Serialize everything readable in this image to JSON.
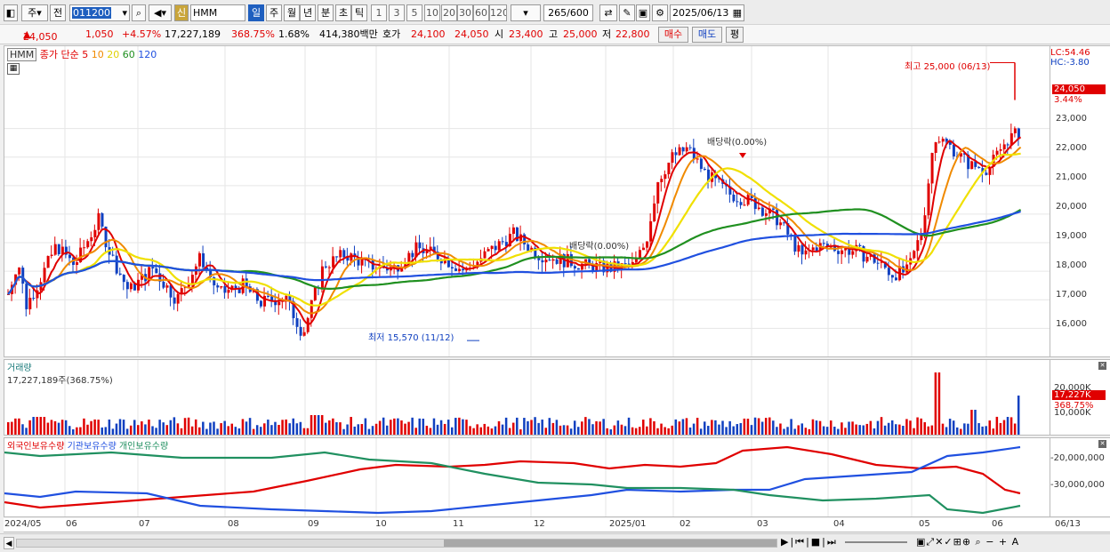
{
  "toolbar": {
    "period_label": "주",
    "compare_label": "전",
    "stock_code": "011200",
    "new_badge": "신",
    "stock_name": "HMM",
    "intervals": [
      "일",
      "주",
      "월",
      "년",
      "분",
      "초",
      "틱"
    ],
    "minutes": [
      "1",
      "3",
      "5",
      "10",
      "20",
      "30",
      "60",
      "120"
    ],
    "count": "265",
    "count_total": "/600",
    "date": "2025/06/13"
  },
  "quote": {
    "price": "24,050",
    "change": "1,050",
    "change_pct": "+4.57%",
    "volume": "17,227,189",
    "volume_ratio": "368.75%",
    "turnover": "1.68%",
    "amount": "414,380백만",
    "ask_label": "호가",
    "ask": "24,100",
    "bid": "24,050",
    "open_label": "시",
    "open": "23,400",
    "high_label": "고",
    "high": "25,000",
    "low_label": "저",
    "low": "22,800",
    "buy_label": "매수",
    "sell_label": "매도",
    "eval_label": "평"
  },
  "price_panel": {
    "title": "HMM",
    "legend_label": "종가 단순",
    "ma_periods": [
      "5",
      "10",
      "20",
      "60",
      "120"
    ],
    "lc": "LC:54.46",
    "hc": "HC:-3.80",
    "current_price": "24,050",
    "current_pct": "3.44%",
    "high_annotation": "최고 25,000 (06/13)",
    "low_annotation": "최저 15,570 (11/12)",
    "dividend_label_1": "배당락(0.00%)",
    "dividend_label_2": "배당락(0.00%)",
    "y_ticks": [
      "23,000",
      "22,000",
      "21,000",
      "20,000",
      "19,000",
      "18,000",
      "17,000",
      "16,000"
    ]
  },
  "volume_panel": {
    "title": "거래량",
    "value": "17,227,189주(368.75%)",
    "y_tick": "20,000K",
    "y_tick_2": "10,000K",
    "current": "17,227K",
    "current_pct": "368.75%"
  },
  "holding_panel": {
    "legend": [
      "외국인보유수량",
      "기관보유수량",
      "개인보유수량"
    ],
    "y_ticks": [
      "-20,000,000",
      "-30,000,000"
    ]
  },
  "x_axis": {
    "labels": [
      "2024/05",
      "06",
      "07",
      "08",
      "09",
      "10",
      "11",
      "12",
      "2025/01",
      "02",
      "03",
      "04",
      "05",
      "06"
    ],
    "last_label": "06/13"
  },
  "colors": {
    "up": "#e00000",
    "down": "#1040c0",
    "ma5": "#e00000",
    "ma10": "#f08a00",
    "ma20": "#f0e000",
    "ma60": "#209020",
    "ma120": "#2050e0"
  }
}
